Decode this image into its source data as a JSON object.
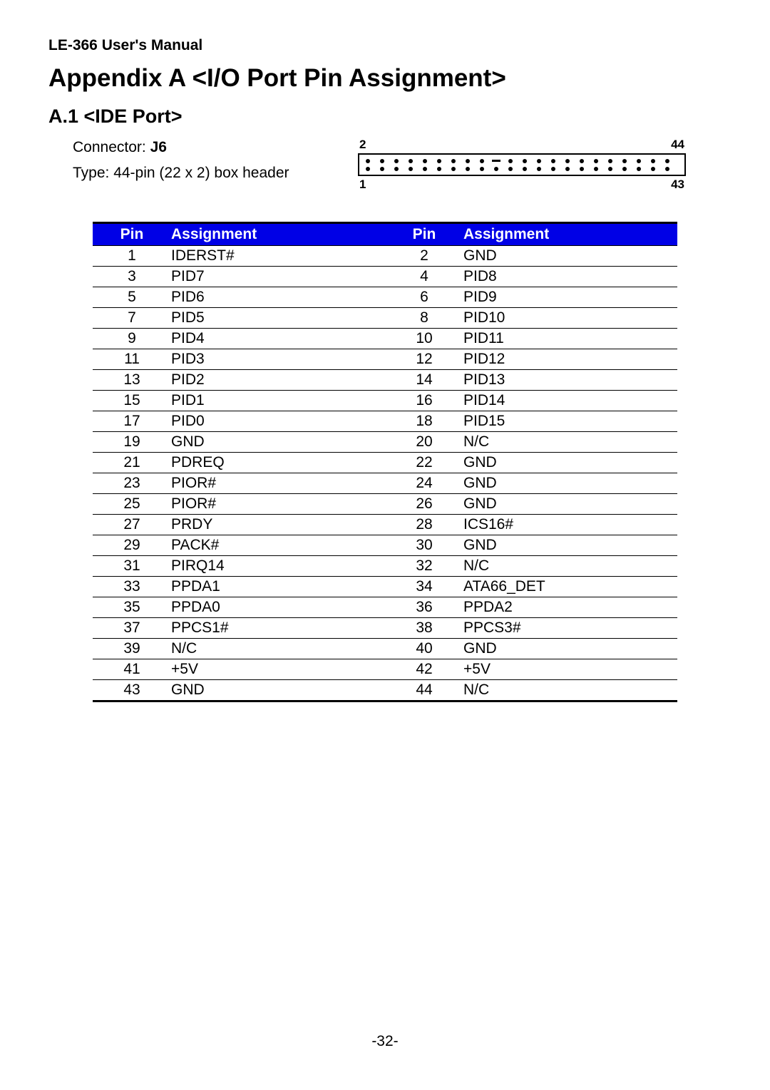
{
  "header": "LE-366 User's Manual",
  "title": "Appendix A <I/O Port Pin Assignment>",
  "section": "A.1 <IDE Port>",
  "connector": {
    "label": "Connector: ",
    "value": "J6"
  },
  "type": "Type: 44-pin (22 x 2) box header",
  "diagram": {
    "top_left": "2",
    "top_right": "44",
    "bottom_left": "1",
    "bottom_right": "43",
    "cols": 22,
    "key_top_index": 9
  },
  "table": {
    "headers": {
      "pin": "Pin",
      "assignment": "Assignment"
    },
    "rows": [
      {
        "p1": "1",
        "a1": "IDERST#",
        "p2": "2",
        "a2": "GND"
      },
      {
        "p1": "3",
        "a1": "PID7",
        "p2": "4",
        "a2": "PID8"
      },
      {
        "p1": "5",
        "a1": "PID6",
        "p2": "6",
        "a2": "PID9"
      },
      {
        "p1": "7",
        "a1": "PID5",
        "p2": "8",
        "a2": "PID10"
      },
      {
        "p1": "9",
        "a1": "PID4",
        "p2": "10",
        "a2": "PID11"
      },
      {
        "p1": "11",
        "a1": "PID3",
        "p2": "12",
        "a2": "PID12"
      },
      {
        "p1": "13",
        "a1": "PID2",
        "p2": "14",
        "a2": "PID13"
      },
      {
        "p1": "15",
        "a1": "PID1",
        "p2": "16",
        "a2": "PID14"
      },
      {
        "p1": "17",
        "a1": "PID0",
        "p2": "18",
        "a2": "PID15"
      },
      {
        "p1": "19",
        "a1": "GND",
        "p2": "20",
        "a2": "N/C"
      },
      {
        "p1": "21",
        "a1": "PDREQ",
        "p2": "22",
        "a2": "GND"
      },
      {
        "p1": "23",
        "a1": "PIOR#",
        "p2": "24",
        "a2": "GND"
      },
      {
        "p1": "25",
        "a1": "PIOR#",
        "p2": "26",
        "a2": "GND"
      },
      {
        "p1": "27",
        "a1": "PRDY",
        "p2": "28",
        "a2": "ICS16#"
      },
      {
        "p1": "29",
        "a1": "PACK#",
        "p2": "30",
        "a2": "GND"
      },
      {
        "p1": "31",
        "a1": "PIRQ14",
        "p2": "32",
        "a2": "N/C"
      },
      {
        "p1": "33",
        "a1": "PPDA1",
        "p2": "34",
        "a2": "ATA66_DET"
      },
      {
        "p1": "35",
        "a1": "PPDA0",
        "p2": "36",
        "a2": "PPDA2"
      },
      {
        "p1": "37",
        "a1": "PPCS1#",
        "p2": "38",
        "a2": "PPCS3#"
      },
      {
        "p1": "39",
        "a1": "N/C",
        "p2": "40",
        "a2": "GND"
      },
      {
        "p1": "41",
        "a1": "+5V",
        "p2": "42",
        "a2": "+5V"
      },
      {
        "p1": "43",
        "a1": "GND",
        "p2": "44",
        "a2": "N/C"
      }
    ]
  },
  "page_number": "-32-"
}
